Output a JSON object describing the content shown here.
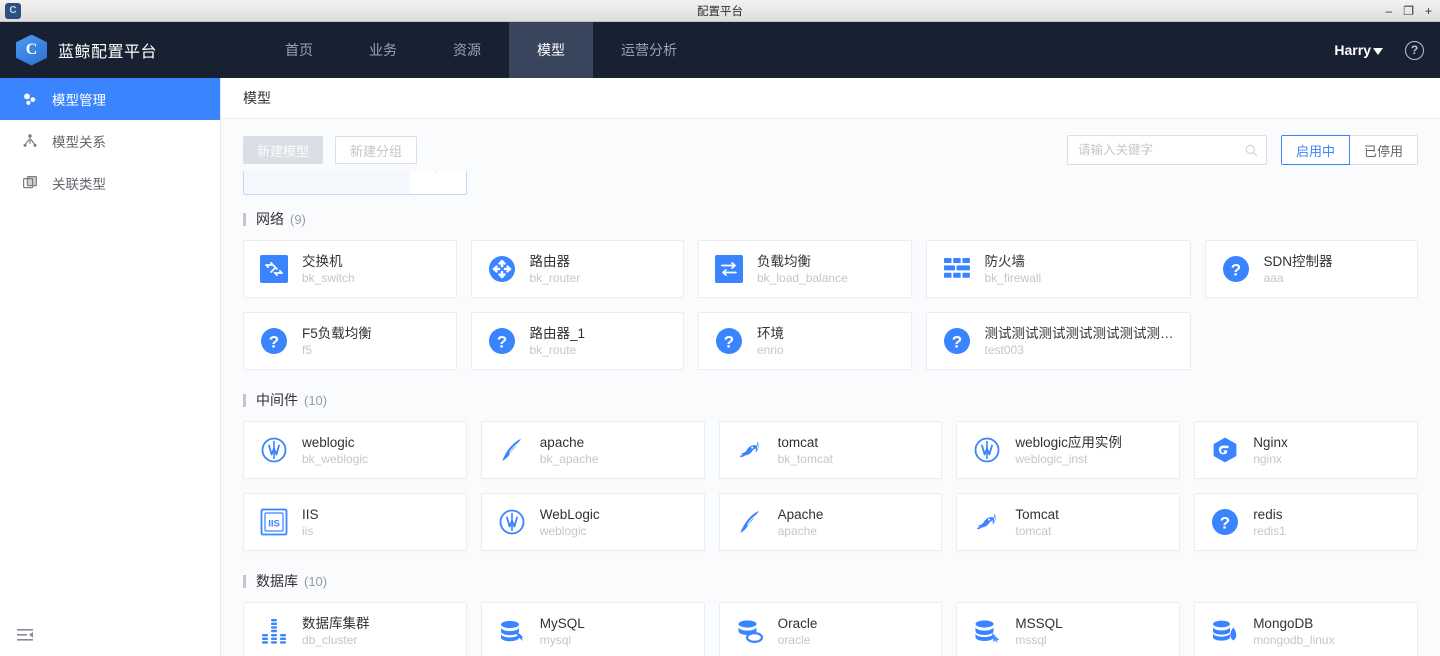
{
  "window": {
    "title": "配置平台",
    "app_icon": "app-icon",
    "controls": {
      "minimize": "–",
      "maximize": "❐",
      "close": "+"
    }
  },
  "topnav": {
    "brand": "蓝鲸配置平台",
    "items": [
      {
        "label": "首页",
        "active": false
      },
      {
        "label": "业务",
        "active": false
      },
      {
        "label": "资源",
        "active": false
      },
      {
        "label": "模型",
        "active": true
      },
      {
        "label": "运营分析",
        "active": false
      }
    ],
    "user": "Harry",
    "help_icon": "question-mark-icon"
  },
  "sidebar": {
    "items": [
      {
        "label": "模型管理",
        "icon": "model-management-icon",
        "active": true
      },
      {
        "label": "模型关系",
        "icon": "model-relation-icon",
        "active": false
      },
      {
        "label": "关联类型",
        "icon": "association-type-icon",
        "active": false
      }
    ],
    "collapse_icon": "collapse-sidebar-icon"
  },
  "page": {
    "title": "模型"
  },
  "toolbar": {
    "new_model": "新建模型",
    "new_group": "新建分组",
    "search_placeholder": "请输入关键字",
    "search_value": "",
    "search_icon": "search-icon",
    "filters": [
      {
        "label": "启用中",
        "active": true
      },
      {
        "label": "已停用",
        "active": false
      }
    ]
  },
  "groups": [
    {
      "name": "网络",
      "count": "(9)",
      "models": [
        {
          "name": "交换机",
          "id": "bk_switch",
          "icon": "switch-icon"
        },
        {
          "name": "路由器",
          "id": "bk_router",
          "icon": "router-icon"
        },
        {
          "name": "负载均衡",
          "id": "bk_load_balance",
          "icon": "load-balance-icon"
        },
        {
          "name": "防火墙",
          "id": "bk_firewall",
          "icon": "firewall-icon"
        },
        {
          "name": "SDN控制器",
          "id": "aaa",
          "icon": "question-icon"
        },
        {
          "name": "F5负载均衡",
          "id": "f5",
          "icon": "question-icon"
        },
        {
          "name": "路由器_1",
          "id": "bk_route",
          "icon": "question-icon"
        },
        {
          "name": "环境",
          "id": "enrio",
          "icon": "question-icon"
        },
        {
          "name": "测试测试测试测试测试测试测…",
          "id": "test003",
          "icon": "question-icon"
        }
      ]
    },
    {
      "name": "中间件",
      "count": "(10)",
      "models": [
        {
          "name": "weblogic",
          "id": "bk_weblogic",
          "icon": "weblogic-icon"
        },
        {
          "name": "apache",
          "id": "bk_apache",
          "icon": "apache-icon"
        },
        {
          "name": "tomcat",
          "id": "bk_tomcat",
          "icon": "tomcat-icon"
        },
        {
          "name": "weblogic应用实例",
          "id": "weblogic_inst",
          "icon": "weblogic-icon"
        },
        {
          "name": "Nginx",
          "id": "nginx",
          "icon": "nginx-icon"
        },
        {
          "name": "IIS",
          "id": "iis",
          "icon": "iis-icon"
        },
        {
          "name": "WebLogic",
          "id": "weblogic",
          "icon": "weblogic-icon"
        },
        {
          "name": "Apache",
          "id": "apache",
          "icon": "apache-icon"
        },
        {
          "name": "Tomcat",
          "id": "tomcat",
          "icon": "tomcat-icon"
        },
        {
          "name": "redis",
          "id": "redis1",
          "icon": "question-icon"
        }
      ]
    },
    {
      "name": "数据库",
      "count": "(10)",
      "models": [
        {
          "name": "数据库集群",
          "id": "db_cluster",
          "icon": "db-cluster-icon"
        },
        {
          "name": "MySQL",
          "id": "mysql",
          "icon": "mysql-icon"
        },
        {
          "name": "Oracle",
          "id": "oracle",
          "icon": "oracle-icon"
        },
        {
          "name": "MSSQL",
          "id": "mssql",
          "icon": "mssql-icon"
        },
        {
          "name": "MongoDB",
          "id": "mongodb_linux",
          "icon": "mongodb-icon"
        }
      ]
    }
  ],
  "colors": {
    "brand_blue": "#3a84ff",
    "nav_bg": "#182132",
    "nav_active": "#38455c",
    "page_bg": "#fafbfd"
  }
}
